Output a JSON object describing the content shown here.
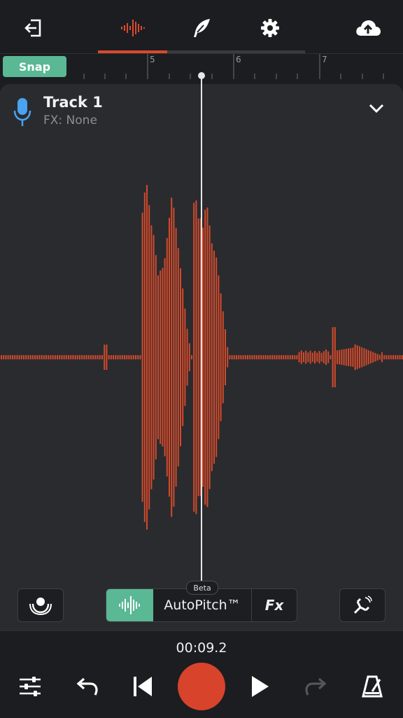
{
  "colors": {
    "accent": "#d84a2c",
    "snap_green": "#5ab894",
    "mic_blue": "#4aa3f0",
    "background": "#1c1d20",
    "track_bg": "#2a2b2f"
  },
  "topbar": {
    "icons": [
      "exit-icon",
      "waveform-icon",
      "quill-icon",
      "gear-icon",
      "cloud-upload-icon"
    ]
  },
  "ruler": {
    "snap_label": "Snap",
    "markers": [
      "5",
      "6",
      "7"
    ]
  },
  "track": {
    "title": "Track 1",
    "fx": "FX: None"
  },
  "controls": {
    "beta_label": "Beta",
    "autopitch_label": "AutoPitch™",
    "fx_label": "Fx"
  },
  "transport": {
    "time": "00:09.2",
    "icons": [
      "mixer-icon",
      "undo-icon",
      "skip-back-icon",
      "record-icon",
      "play-icon",
      "redo-icon",
      "metronome-icon"
    ]
  }
}
